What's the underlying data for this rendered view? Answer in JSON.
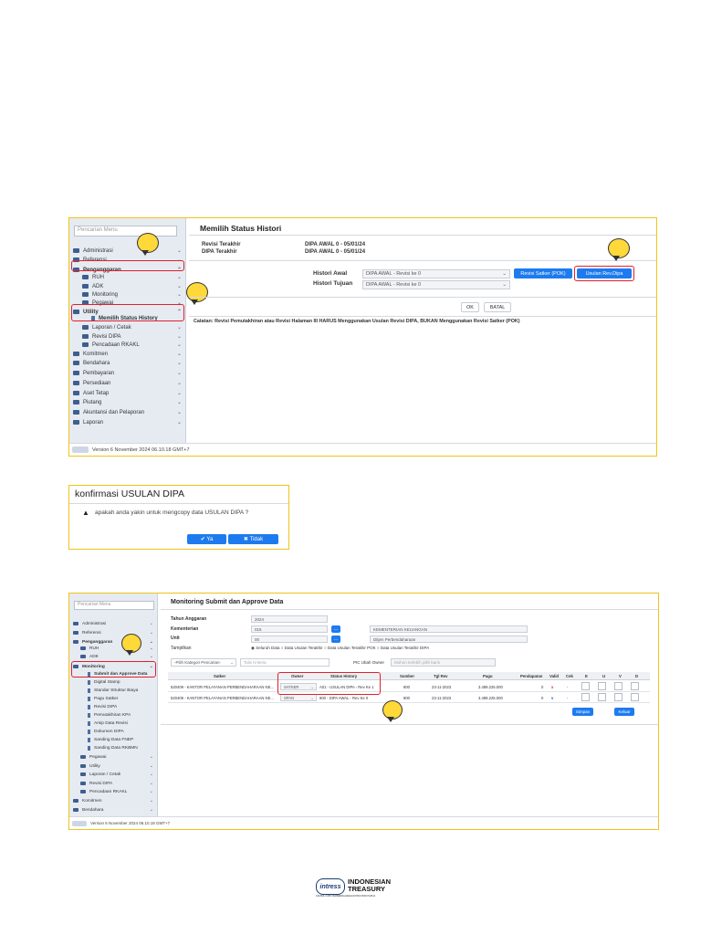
{
  "shot1": {
    "search_placeholder": "Pencarian Menu",
    "menu": [
      {
        "label": "Administrasi"
      },
      {
        "label": "Referensi"
      },
      {
        "label": "Penganggaran"
      },
      {
        "label": "RUH"
      },
      {
        "label": "ADK"
      },
      {
        "label": "Monitoring"
      },
      {
        "label": "Pegawai"
      },
      {
        "label": "Utility"
      },
      {
        "label": "Memilih Status History"
      },
      {
        "label": "Laporan / Cetak"
      },
      {
        "label": "Revisi DIPA"
      },
      {
        "label": "Pencadaan RKAKL"
      },
      {
        "label": "Komitmen"
      },
      {
        "label": "Bendahara"
      },
      {
        "label": "Pembayaran"
      },
      {
        "label": "Persediaan"
      },
      {
        "label": "Aset Tetap"
      },
      {
        "label": "Piutang"
      },
      {
        "label": "Akuntansi dan Pelaporan"
      },
      {
        "label": "Laporan"
      }
    ],
    "title": "Memilih Status Histori",
    "revisi_terakhir_label": "Revisi Terakhir",
    "revisi_terakhir_value": "DIPA AWAL 0 - 05/01/24",
    "dipa_terakhir_label": "DIPA Terakhir",
    "dipa_terakhir_value": "DIPA AWAL 0 - 05/01/24",
    "histori_awal_label": "Histori Awal",
    "histori_awal_value": "DIPA AWAL - Revisi ke 0",
    "histori_tujuan_label": "Histori Tujuan",
    "histori_tujuan_value": "DIPA AWAL - Revisi ke 0",
    "btn_revisi_satker": "Revisi Satker (POK)",
    "btn_usulan": "Usulan Rev.Dipa",
    "btn_ok": "OK",
    "btn_batal": "BATAL",
    "catatan": "Catatan: Revisi Pemutakhiran atau Revisi Halaman III HARUS Menggunakan Usulan Revisi DIPA, BUKAN Menggunakan Revisi Satker (POK)",
    "version": "Version 6 November 2024 06.10.18 GMT+7"
  },
  "dialog": {
    "title": "konfirmasi USULAN DIPA",
    "message": "apakah anda yakin untuk mengcopy data USULAN DIPA ?",
    "btn_ya": "Ya",
    "btn_tidak": "Tidak"
  },
  "shot2": {
    "search_placeholder": "Pencarian Menu",
    "menu": [
      {
        "label": "Administrasi"
      },
      {
        "label": "Referensi"
      },
      {
        "label": "Penganggaran"
      },
      {
        "label": "RUH"
      },
      {
        "label": "ADK"
      },
      {
        "label": "Monitoring"
      },
      {
        "label": "Submit dan Approve Data"
      },
      {
        "label": "Digital Stamp"
      },
      {
        "label": "Standar Struktur Biaya"
      },
      {
        "label": "Pagu Satker"
      },
      {
        "label": "Revisi DIPA"
      },
      {
        "label": "Pemutakhiran KPA"
      },
      {
        "label": "Arsip Data Revisi"
      },
      {
        "label": "Dokumen DIPA"
      },
      {
        "label": "Sanding Data FNEP"
      },
      {
        "label": "Sanding Data RKBMN"
      },
      {
        "label": "Pegawai"
      },
      {
        "label": "Utility"
      },
      {
        "label": "Laporan / Cetak"
      },
      {
        "label": "Revisi DIPA"
      },
      {
        "label": "Pencadaan RKAKL"
      },
      {
        "label": "Komitmen"
      },
      {
        "label": "Bendahara"
      }
    ],
    "title": "Monitoring Submit dan Approve Data",
    "tahun_label": "Tahun Anggaran",
    "tahun_value": "2024",
    "kementerian_label": "Kementerian",
    "kementerian_code": "015",
    "kementerian_name": "KEMENTERIAN KEUANGAN",
    "unit_label": "Unit",
    "unit_code": "00",
    "unit_name": "Ditjen Perbendaharaan",
    "tampilkan_label": "Tampilkan",
    "radio": [
      "Seluruh Data",
      "Data Usulan Terakhir",
      "Data Usulan Terakhir POK",
      "Data Usulan Terakhir DIPA"
    ],
    "kategori_select": "-Pilih Kategori Pencarian-",
    "kriteria_placeholder": "Talis Kriteria",
    "pic_label": "PIC Ubah Owner",
    "pic_placeholder": "Mohon terlebih pilih baris",
    "columns": [
      "Satker",
      "Owner",
      "Status History",
      "Sumber",
      "Tgl Rev",
      "Pagu",
      "Pendapatan",
      "Valid",
      "Cek",
      "E",
      "U",
      "V",
      "D"
    ],
    "rows": [
      {
        "satker": "520409 - KANTOR PELAYANAN PERBENDAHARAAN NE...",
        "owner": "SATKER",
        "status": "A01 - USULAN DIPA - Rev Ke 1",
        "sumber": "800",
        "tgl": "23-11-2023",
        "pagu": "3.489.225.000",
        "pendapatan": "0",
        "valid": "x",
        "cek": "-"
      },
      {
        "satker": "520409 - KANTOR PELAYANAN PERBENDAHARAAN NE...",
        "owner": "SPAN",
        "status": "800 - DIPA AWAL - Rev Ke 0",
        "sumber": "800",
        "tgl": "23-11-2023",
        "pagu": "3.489.225.000",
        "pendapatan": "0",
        "valid": "v",
        "cek": "-"
      }
    ],
    "btn_simpan": "Simpan",
    "btn_keluar": "Keluar",
    "version": "Version 6 November 2024 06.10.18 GMT+7"
  },
  "brand": {
    "logo_text": "intress",
    "line1": "INDONESIAN",
    "line2": "TREASURY",
    "tagline": "KANWIL DJPb PERBENDAHARAAN PROVINSI PAPUA"
  },
  "colors": {
    "accent": "#1e7bef",
    "highlight": "#e0202c",
    "frame": "#f0c419",
    "bubble": "#ffd83a"
  }
}
